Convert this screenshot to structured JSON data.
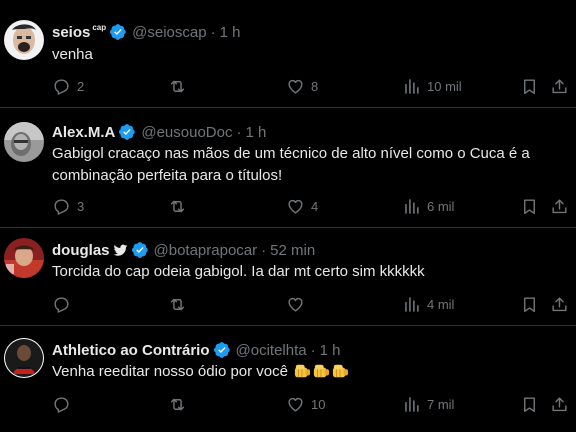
{
  "tweets": [
    {
      "name": "seios",
      "name_sup": "cap",
      "handle": "@seioscap",
      "time": "1 h",
      "text": "venha",
      "replies": "2",
      "retweets": "",
      "likes": "8",
      "views": "10 mil",
      "verified": true
    },
    {
      "name": "Alex.M.A",
      "handle": "@eusouoDoc",
      "time": "1 h",
      "text": "Gabigol cracaço nas mãos de um técnico de alto nível como o Cuca é a combinação perfeita para o títulos!",
      "replies": "3",
      "retweets": "",
      "likes": "4",
      "views": "6 mil",
      "verified": true
    },
    {
      "name": "douglas",
      "handle": "@botaprapocar",
      "time": "52 min",
      "text": "Torcida do cap odeia gabigol. Ia dar mt certo sim kkkkkk",
      "replies": "",
      "retweets": "",
      "likes": "",
      "views": "4 mil",
      "verified": true
    },
    {
      "name": "Athletico ao Contrário",
      "handle": "@ocitelhta",
      "time": "1 h",
      "text": "Venha reeditar nosso ódio por você",
      "replies": "",
      "retweets": "",
      "likes": "10",
      "views": "7 mil",
      "verified": true
    }
  ],
  "separator": "·",
  "icons": {
    "reply": "reply-icon",
    "retweet": "retweet-icon",
    "like": "heart-icon",
    "views": "views-icon",
    "bookmark": "bookmark-icon",
    "share": "share-icon",
    "verified": "verified-badge-icon",
    "twitter_bird": "twitter-bird-icon",
    "fist_emoji": "oncoming-fist-icon"
  },
  "colors": {
    "background": "#000000",
    "text": "#e7e9ea",
    "muted": "#71767b",
    "divider": "#2f3336",
    "verified": "#1d9bf0"
  }
}
